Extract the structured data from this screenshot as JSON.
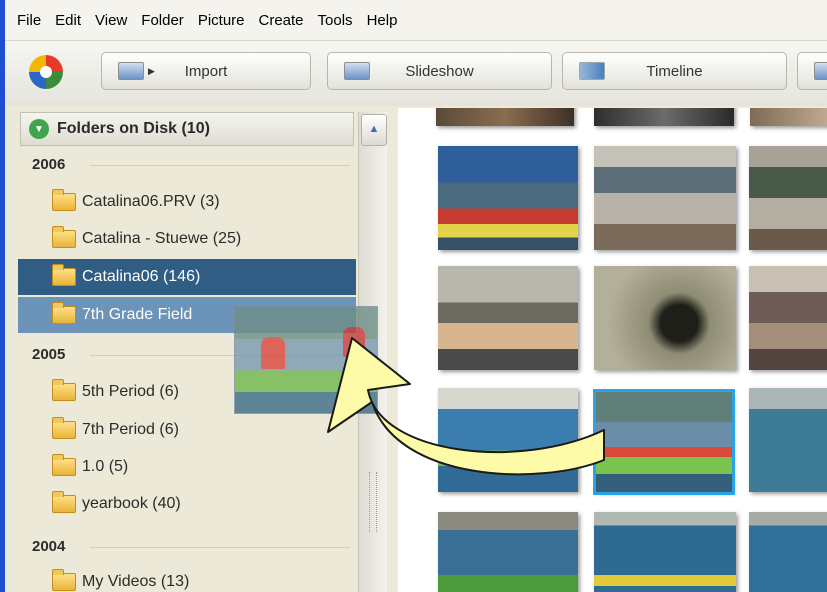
{
  "menu": [
    "File",
    "Edit",
    "View",
    "Folder",
    "Picture",
    "Create",
    "Tools",
    "Help"
  ],
  "toolbar": {
    "import_label": "Import",
    "slideshow_label": "Slideshow",
    "timeline_label": "Timeline"
  },
  "folders_header": "Folders on Disk (10)",
  "groups": [
    {
      "year": "2006",
      "items": [
        "Catalina06.PRV (3)",
        "Catalina - Stuewe (25)",
        "Catalina06 (146)",
        "7th Grade Field"
      ]
    },
    {
      "year": "2005",
      "items": [
        "5th Period (6)",
        "7th Period (6)",
        "1.0 (5)",
        "yearbook (40)"
      ]
    },
    {
      "year": "2004",
      "items": [
        "My Videos (13)"
      ]
    }
  ],
  "colors": {
    "selected_row": "#2f5d84",
    "drop_target_row": "#6c93b8",
    "arrow_fill": "#fdfba8",
    "selection_outline": "#29a3e6"
  },
  "icons": [
    "picasa-logo-icon",
    "import-icon",
    "slideshow-icon",
    "timeline-icon",
    "folder-icon",
    "expand-toggle-icon",
    "scroll-up-icon"
  ]
}
